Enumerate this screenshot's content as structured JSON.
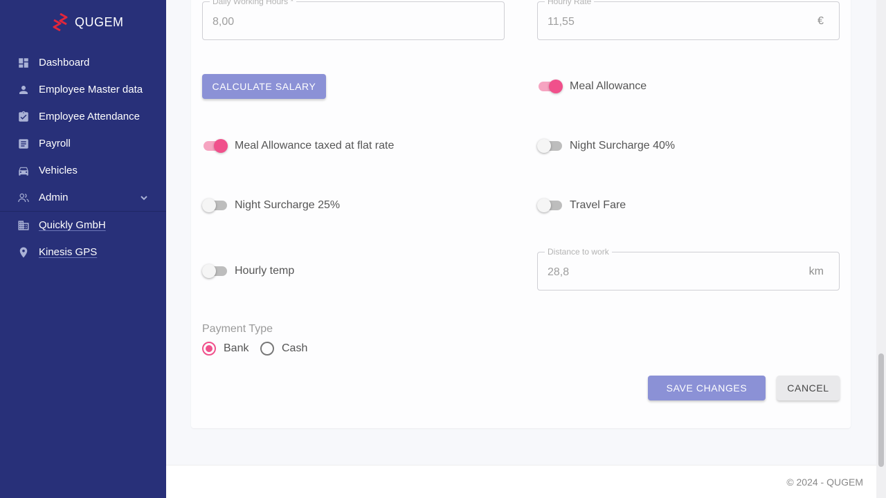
{
  "brand": {
    "name": "QUGEM",
    "accent": "#e2263b"
  },
  "sidebar": {
    "items": [
      {
        "label": "Dashboard",
        "icon": "dashboard-icon"
      },
      {
        "label": "Employee Master data",
        "icon": "person-icon"
      },
      {
        "label": "Employee Attendance",
        "icon": "clipboard-check-icon"
      },
      {
        "label": "Payroll",
        "icon": "receipt-icon"
      },
      {
        "label": "Vehicles",
        "icon": "car-icon"
      },
      {
        "label": "Admin",
        "icon": "users-icon"
      }
    ],
    "links": [
      {
        "label": "Quickly GmbH",
        "icon": "building-icon"
      },
      {
        "label": "Kinesis GPS",
        "icon": "location-pin-icon"
      }
    ]
  },
  "form": {
    "daily_hours": {
      "label": "Daily Working Hours *",
      "value": "8,00"
    },
    "hourly_rate": {
      "label": "Hourly Rate",
      "value": "11,55",
      "suffix": "€"
    },
    "calculate_label": "CALCULATE SALARY",
    "toggles": {
      "meal_allowance": {
        "label": "Meal Allowance",
        "on": true
      },
      "meal_flat": {
        "label": "Meal Allowance taxed at flat rate",
        "on": true
      },
      "night40": {
        "label": "Night Surcharge 40%",
        "on": false
      },
      "night25": {
        "label": "Night Surcharge 25%",
        "on": false
      },
      "travel": {
        "label": "Travel Fare",
        "on": false
      },
      "hourly_temp": {
        "label": "Hourly temp",
        "on": false
      }
    },
    "distance": {
      "label": "Distance to work",
      "value": "28,8",
      "suffix": "km"
    },
    "payment": {
      "label": "Payment Type",
      "options": [
        "Bank",
        "Cash"
      ],
      "selected": "Bank"
    },
    "save_label": "SAVE CHANGES",
    "cancel_label": "CANCEL"
  },
  "footer": {
    "text": "© 2024 - QUGEM"
  },
  "colors": {
    "sidebar_bg": "#283079",
    "primary": "#8b91d6",
    "accent_pink": "#f0508b"
  }
}
